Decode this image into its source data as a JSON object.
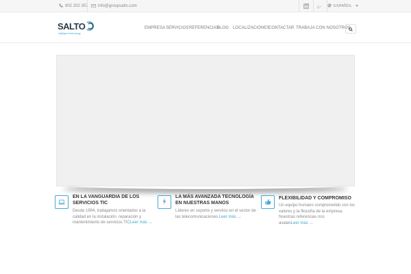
{
  "topbar": {
    "phone": "902 202 357",
    "email": "info@groupsalto.com",
    "language": "ESPAÑOL",
    "icons": [
      "phone-icon",
      "mail-icon",
      "linkedin-icon",
      "google-plus-icon",
      "globe-icon",
      "caret-down-icon"
    ]
  },
  "header": {
    "logo_text": "SALTO",
    "logo_tagline": "intelligent technology",
    "nav": [
      "EMPRESA",
      "SERVICIOS",
      "REFERENCIAS",
      "BLOG",
      "LOCALIZACIONES",
      "CONTACTAR",
      "TRABAJA CON NOSOTROS"
    ]
  },
  "features": [
    {
      "icon": "laptop-icon",
      "title": "EN LA VANGUARDIA DE LOS SERVICIOS TIC",
      "text": "Desde 1994, trabajamos orientados a la calidad en la instalación, reparación y mantenimiento de servicios TIC",
      "more": "Leer más →"
    },
    {
      "icon": "lightning-icon",
      "title": "LA MÁS AVANZADA TECNOLOGÍA EN NUESTRAS MANOS",
      "text": "Líderes en soporte y servicio en el sector de las telecomunicaciones.",
      "more": "Leer más →"
    },
    {
      "icon": "thumbs-up-icon",
      "title": "FLEXIBILIDAD Y COMPROMISO",
      "text": "Un equipo humano comprometido con los valores y la filosofía de la empresa. Nuestras referencias nos avalan",
      "more": "Leer más →"
    }
  ],
  "colors": {
    "accent": "#3aa8d6",
    "logo_dark": "#2d3a49",
    "topbar_bg": "#f6f6f6",
    "slider_bg": "#f0f0f0"
  }
}
